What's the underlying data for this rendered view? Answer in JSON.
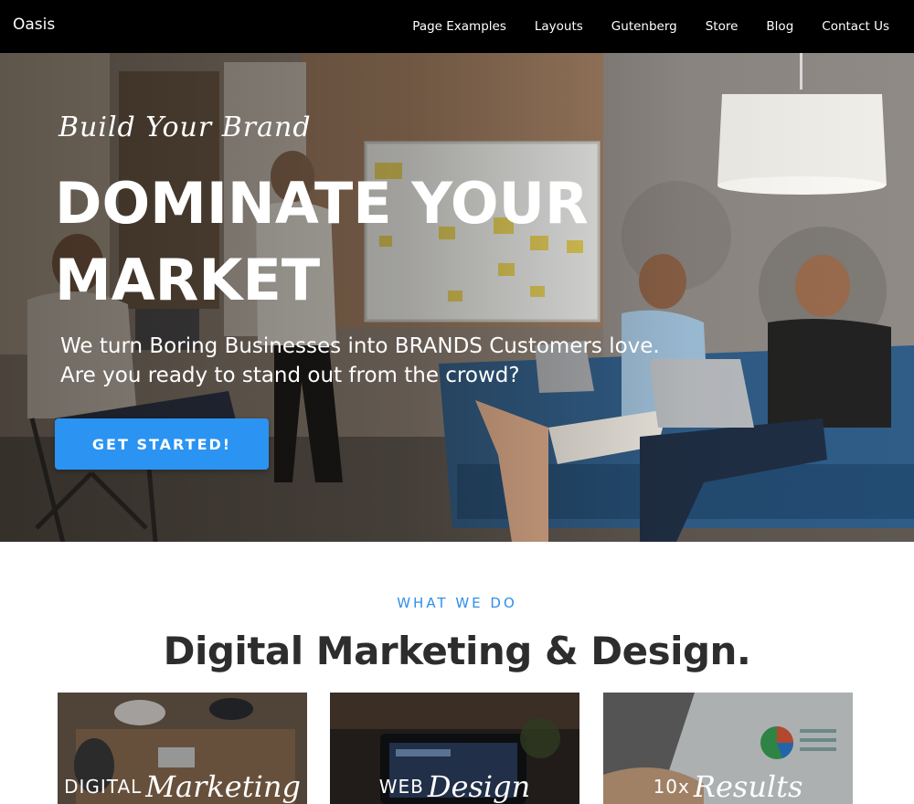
{
  "header": {
    "brand": "Oasis",
    "nav": [
      "Page Examples",
      "Layouts",
      "Gutenberg",
      "Store",
      "Blog",
      "Contact Us"
    ]
  },
  "hero": {
    "tagline": "Build Your Brand",
    "headline_line1": "DOMINATE YOUR",
    "headline_line2": "MARKET",
    "subtext_line1": "We turn Boring Businesses into BRANDS Customers love.",
    "subtext_line2": "Are you ready to stand out from the crowd?",
    "cta_label": "GET STARTED!"
  },
  "services": {
    "eyebrow": "WHAT WE DO",
    "title": "Digital Marketing & Design.",
    "cards": [
      {
        "plain": "DIGITAL",
        "script": "Marketing"
      },
      {
        "plain": "WEB",
        "script": "Design"
      },
      {
        "plain": "10x",
        "script": "Results"
      }
    ]
  },
  "colors": {
    "accent": "#2b93f2",
    "eyebrow": "#2e8fe8",
    "nav_bg": "#000000",
    "title_text": "#2d2d2d"
  }
}
